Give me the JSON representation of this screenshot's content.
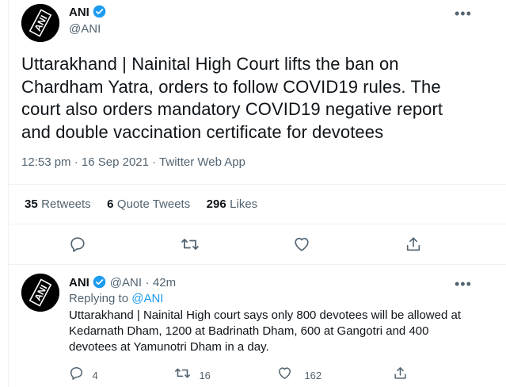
{
  "main_tweet": {
    "author_name": "ANI",
    "author_handle": "@ANI",
    "text_lines": [
      "Uttarakhand | Nainital High Court lifts the ban on",
      "Chardham Yatra, orders to follow COVID19 rules. The",
      "court also orders mandatory COVID19 negative report",
      "and double vaccination certificate for devotees"
    ],
    "time": "12:53 pm",
    "separator": "·",
    "date": "16 Sep 2021",
    "source": "Twitter Web App",
    "retweets_count": "35",
    "retweets_label": "Retweets",
    "quote_count": "6",
    "quote_label": "Quote Tweets",
    "likes_count": "296",
    "likes_label": "Likes"
  },
  "reply_tweet": {
    "author_name": "ANI",
    "author_handle": "@ANI",
    "dot": "·",
    "age": "42m",
    "replying_prefix": "Replying to",
    "replying_handle": "@ANI",
    "text_lines": [
      "Uttarakhand | Nainital High court says only 800 devotees will be allowed at",
      "Kedarnath Dham, 1200 at Badrinath Dham, 600 at Gangotri and 400",
      "devotees at Yamunotri Dham in a day."
    ],
    "reply_count": "4",
    "retweet_count": "16",
    "like_count": "162"
  },
  "avatar_text": "ANI",
  "colors": {
    "accent": "#1d9bf0",
    "text": "#0f1419",
    "muted": "#536471",
    "divider": "#eff3f4"
  },
  "icons": [
    "verified-badge-icon",
    "more-icon",
    "reply-icon",
    "retweet-icon",
    "like-icon",
    "share-icon"
  ]
}
